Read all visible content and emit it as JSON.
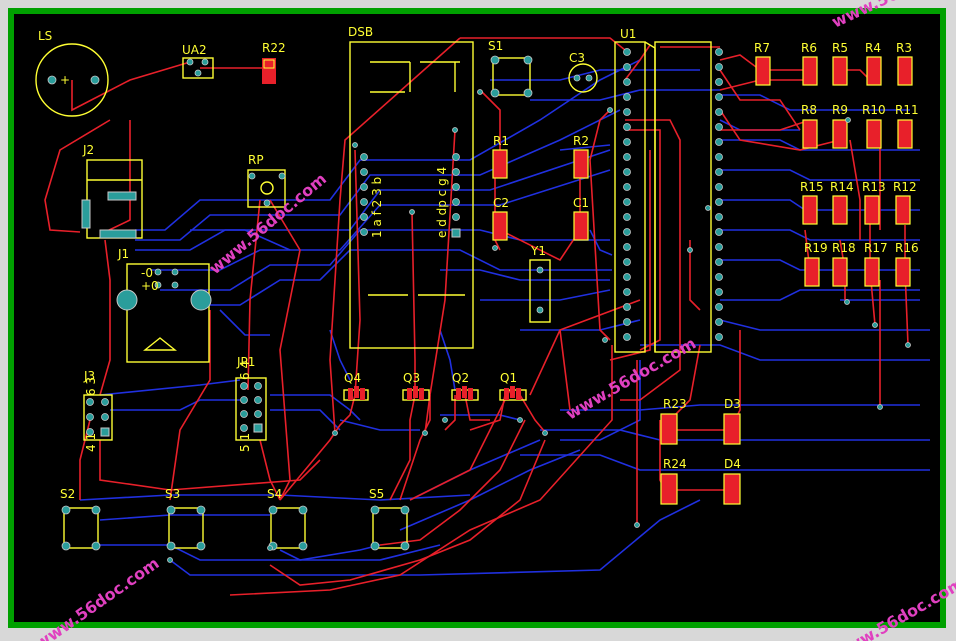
{
  "component_labels": {
    "ls": "LS",
    "ua2": "UA2",
    "r22": "R22",
    "dsb": "DSB",
    "s1": "S1",
    "c3": "C3",
    "u1": "U1",
    "r7": "R7",
    "r6": "R6",
    "r5": "R5",
    "r4": "R4",
    "r3": "R3",
    "r8": "R8",
    "r9": "R9",
    "r10": "R10",
    "r11": "R11",
    "r15": "R15",
    "r14": "R14",
    "r13": "R13",
    "r12": "R12",
    "r19": "R19",
    "r18": "R18",
    "r17": "R17",
    "r16": "R16",
    "j2": "J2",
    "rp": "RP",
    "r1": "R1",
    "r2": "R2",
    "c2": "C2",
    "c1": "C1",
    "j1": "J1",
    "y1": "Y1",
    "j3": "J3",
    "jp1": "JP1",
    "q4": "Q4",
    "q3": "Q3",
    "q2": "Q2",
    "q1": "Q1",
    "r23": "R23",
    "d3": "D3",
    "r24": "R24",
    "d4": "D4",
    "s2": "S2",
    "s3": "S3",
    "s4": "S4",
    "s5": "S5"
  },
  "silk_text": {
    "ls_plus": "+",
    "dsb_left_pins": "1 a f 2 3 b",
    "dsb_right_pins": "e d dp c g 4",
    "j1_pin_top": "-0",
    "j1_pin_bot": "+0",
    "j3_top": "6 3",
    "j3_bot": "4 1",
    "jp1_top": "6 4",
    "jp1_bot": "5 1"
  },
  "watermark": "www.56doc.com",
  "colors": {
    "background": "#000000",
    "outline": "#00a000",
    "silkscreen": "#ffff33",
    "top_copper": "#e8202a",
    "bottom_copper": "#2030e0",
    "via": "#2a9d9b"
  }
}
